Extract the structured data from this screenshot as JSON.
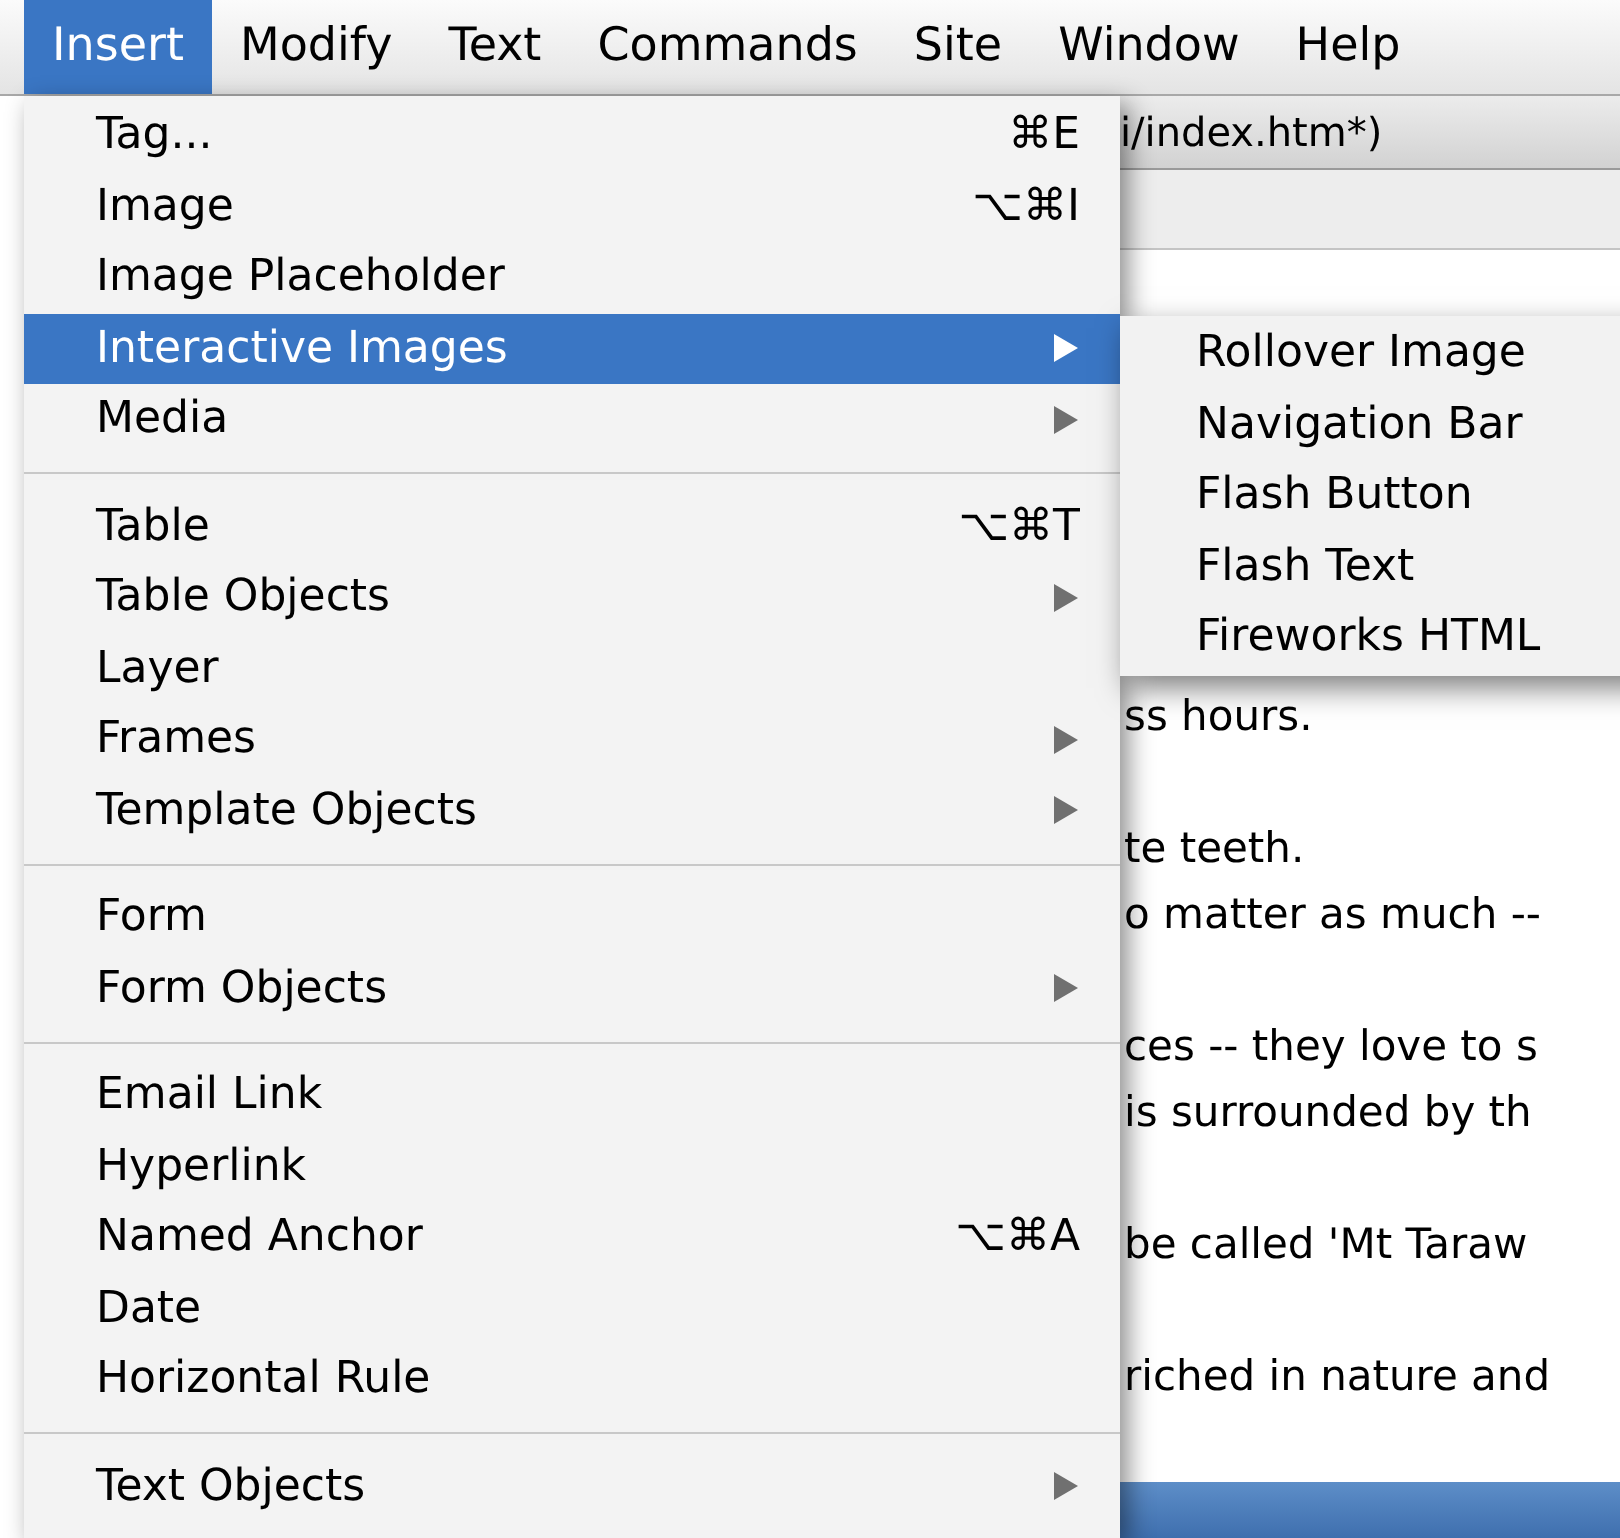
{
  "menubar": [
    {
      "label": "Insert",
      "selected": true
    },
    {
      "label": "Modify",
      "selected": false
    },
    {
      "label": "Text",
      "selected": false
    },
    {
      "label": "Commands",
      "selected": false
    },
    {
      "label": "Site",
      "selected": false
    },
    {
      "label": "Window",
      "selected": false
    },
    {
      "label": "Help",
      "selected": false
    }
  ],
  "menu": {
    "items": [
      {
        "kind": "item",
        "label": "Tag...",
        "shortcut": "⌘E",
        "submenu": false,
        "selected": false
      },
      {
        "kind": "item",
        "label": "Image",
        "shortcut": "⌥⌘I",
        "submenu": false,
        "selected": false
      },
      {
        "kind": "item",
        "label": "Image Placeholder",
        "submenu": false,
        "selected": false
      },
      {
        "kind": "item",
        "label": "Interactive Images",
        "submenu": true,
        "selected": true
      },
      {
        "kind": "item",
        "label": "Media",
        "submenu": true,
        "selected": false
      },
      {
        "kind": "separator"
      },
      {
        "kind": "item",
        "label": "Table",
        "shortcut": "⌥⌘T",
        "submenu": false,
        "selected": false
      },
      {
        "kind": "item",
        "label": "Table Objects",
        "submenu": true,
        "selected": false
      },
      {
        "kind": "item",
        "label": "Layer",
        "submenu": false,
        "selected": false
      },
      {
        "kind": "item",
        "label": "Frames",
        "submenu": true,
        "selected": false
      },
      {
        "kind": "item",
        "label": "Template Objects",
        "submenu": true,
        "selected": false
      },
      {
        "kind": "separator"
      },
      {
        "kind": "item",
        "label": "Form",
        "submenu": false,
        "selected": false
      },
      {
        "kind": "item",
        "label": "Form Objects",
        "submenu": true,
        "selected": false
      },
      {
        "kind": "separator"
      },
      {
        "kind": "item",
        "label": "Email Link",
        "submenu": false,
        "selected": false
      },
      {
        "kind": "item",
        "label": "Hyperlink",
        "submenu": false,
        "selected": false
      },
      {
        "kind": "item",
        "label": "Named Anchor",
        "shortcut": "⌥⌘A",
        "submenu": false,
        "selected": false
      },
      {
        "kind": "item",
        "label": "Date",
        "submenu": false,
        "selected": false
      },
      {
        "kind": "item",
        "label": "Horizontal Rule",
        "submenu": false,
        "selected": false
      },
      {
        "kind": "separator"
      },
      {
        "kind": "item",
        "label": "Text Objects",
        "submenu": true,
        "selected": false
      }
    ]
  },
  "submenu": {
    "items": [
      {
        "label": "Rollover Image"
      },
      {
        "label": "Navigation Bar"
      },
      {
        "label": "Flash Button"
      },
      {
        "label": "Flash Text"
      },
      {
        "label": "Fireworks HTML"
      }
    ]
  },
  "document": {
    "title": "i/index.htm*)",
    "lines": [
      {
        "kind": "text",
        "text": "ss hours."
      },
      {
        "kind": "blank"
      },
      {
        "kind": "text",
        "text": "te teeth."
      },
      {
        "kind": "text",
        "text": "o matter as much --"
      },
      {
        "kind": "blank"
      },
      {
        "kind": "text",
        "text": "ces -- they love to s"
      },
      {
        "kind": "text",
        "text": "is surrounded by th"
      },
      {
        "kind": "blank"
      },
      {
        "kind": "text",
        "text": "be called 'Mt Taraw"
      },
      {
        "kind": "blank"
      },
      {
        "kind": "text",
        "text": "riched in nature and"
      }
    ]
  }
}
